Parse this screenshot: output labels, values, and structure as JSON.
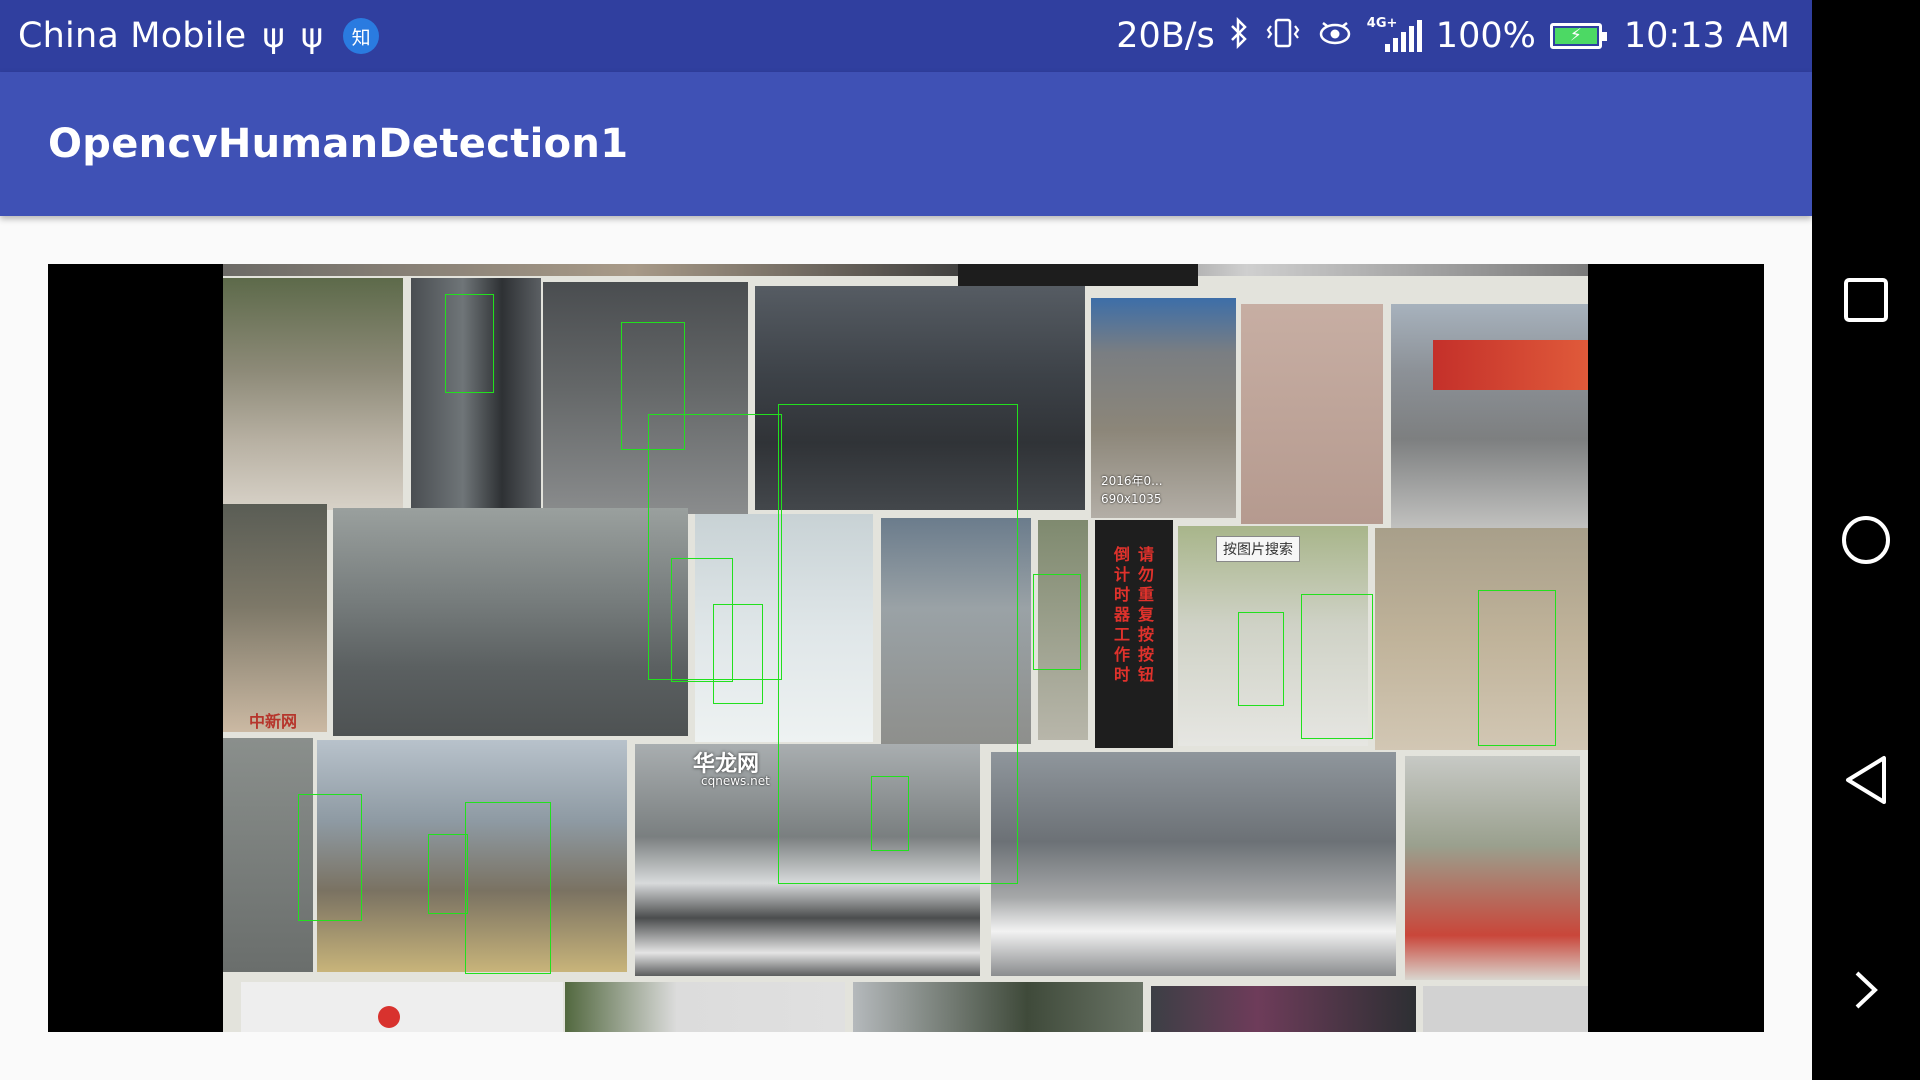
{
  "status_bar": {
    "carrier": "China Mobile",
    "app_badge": "知",
    "net_speed": "20B/s",
    "network_type": "4G+",
    "battery_percent": "100%",
    "battery_level": 1.0,
    "time": "10:13 AM",
    "icons": [
      "usb-icon",
      "usb-icon",
      "zhihu-icon",
      "bluetooth-icon",
      "vibrate-icon",
      "eye-icon",
      "signal-icon",
      "battery-icon"
    ]
  },
  "app_bar": {
    "title": "OpencvHumanDetection1"
  },
  "camera": {
    "photo_texts": {
      "overlay_date": "2016年0...",
      "overlay_dims": "690x1035",
      "tooltip": "按图片搜索",
      "sign_text": "请勿重复按按钮 倒计时器工作时",
      "watermark_1": "中新网",
      "watermark_2": "华龙网",
      "watermark_3": "cqnews.net"
    }
  },
  "nav_bar": {
    "buttons": [
      "recent-apps",
      "home",
      "back",
      "expand"
    ]
  }
}
